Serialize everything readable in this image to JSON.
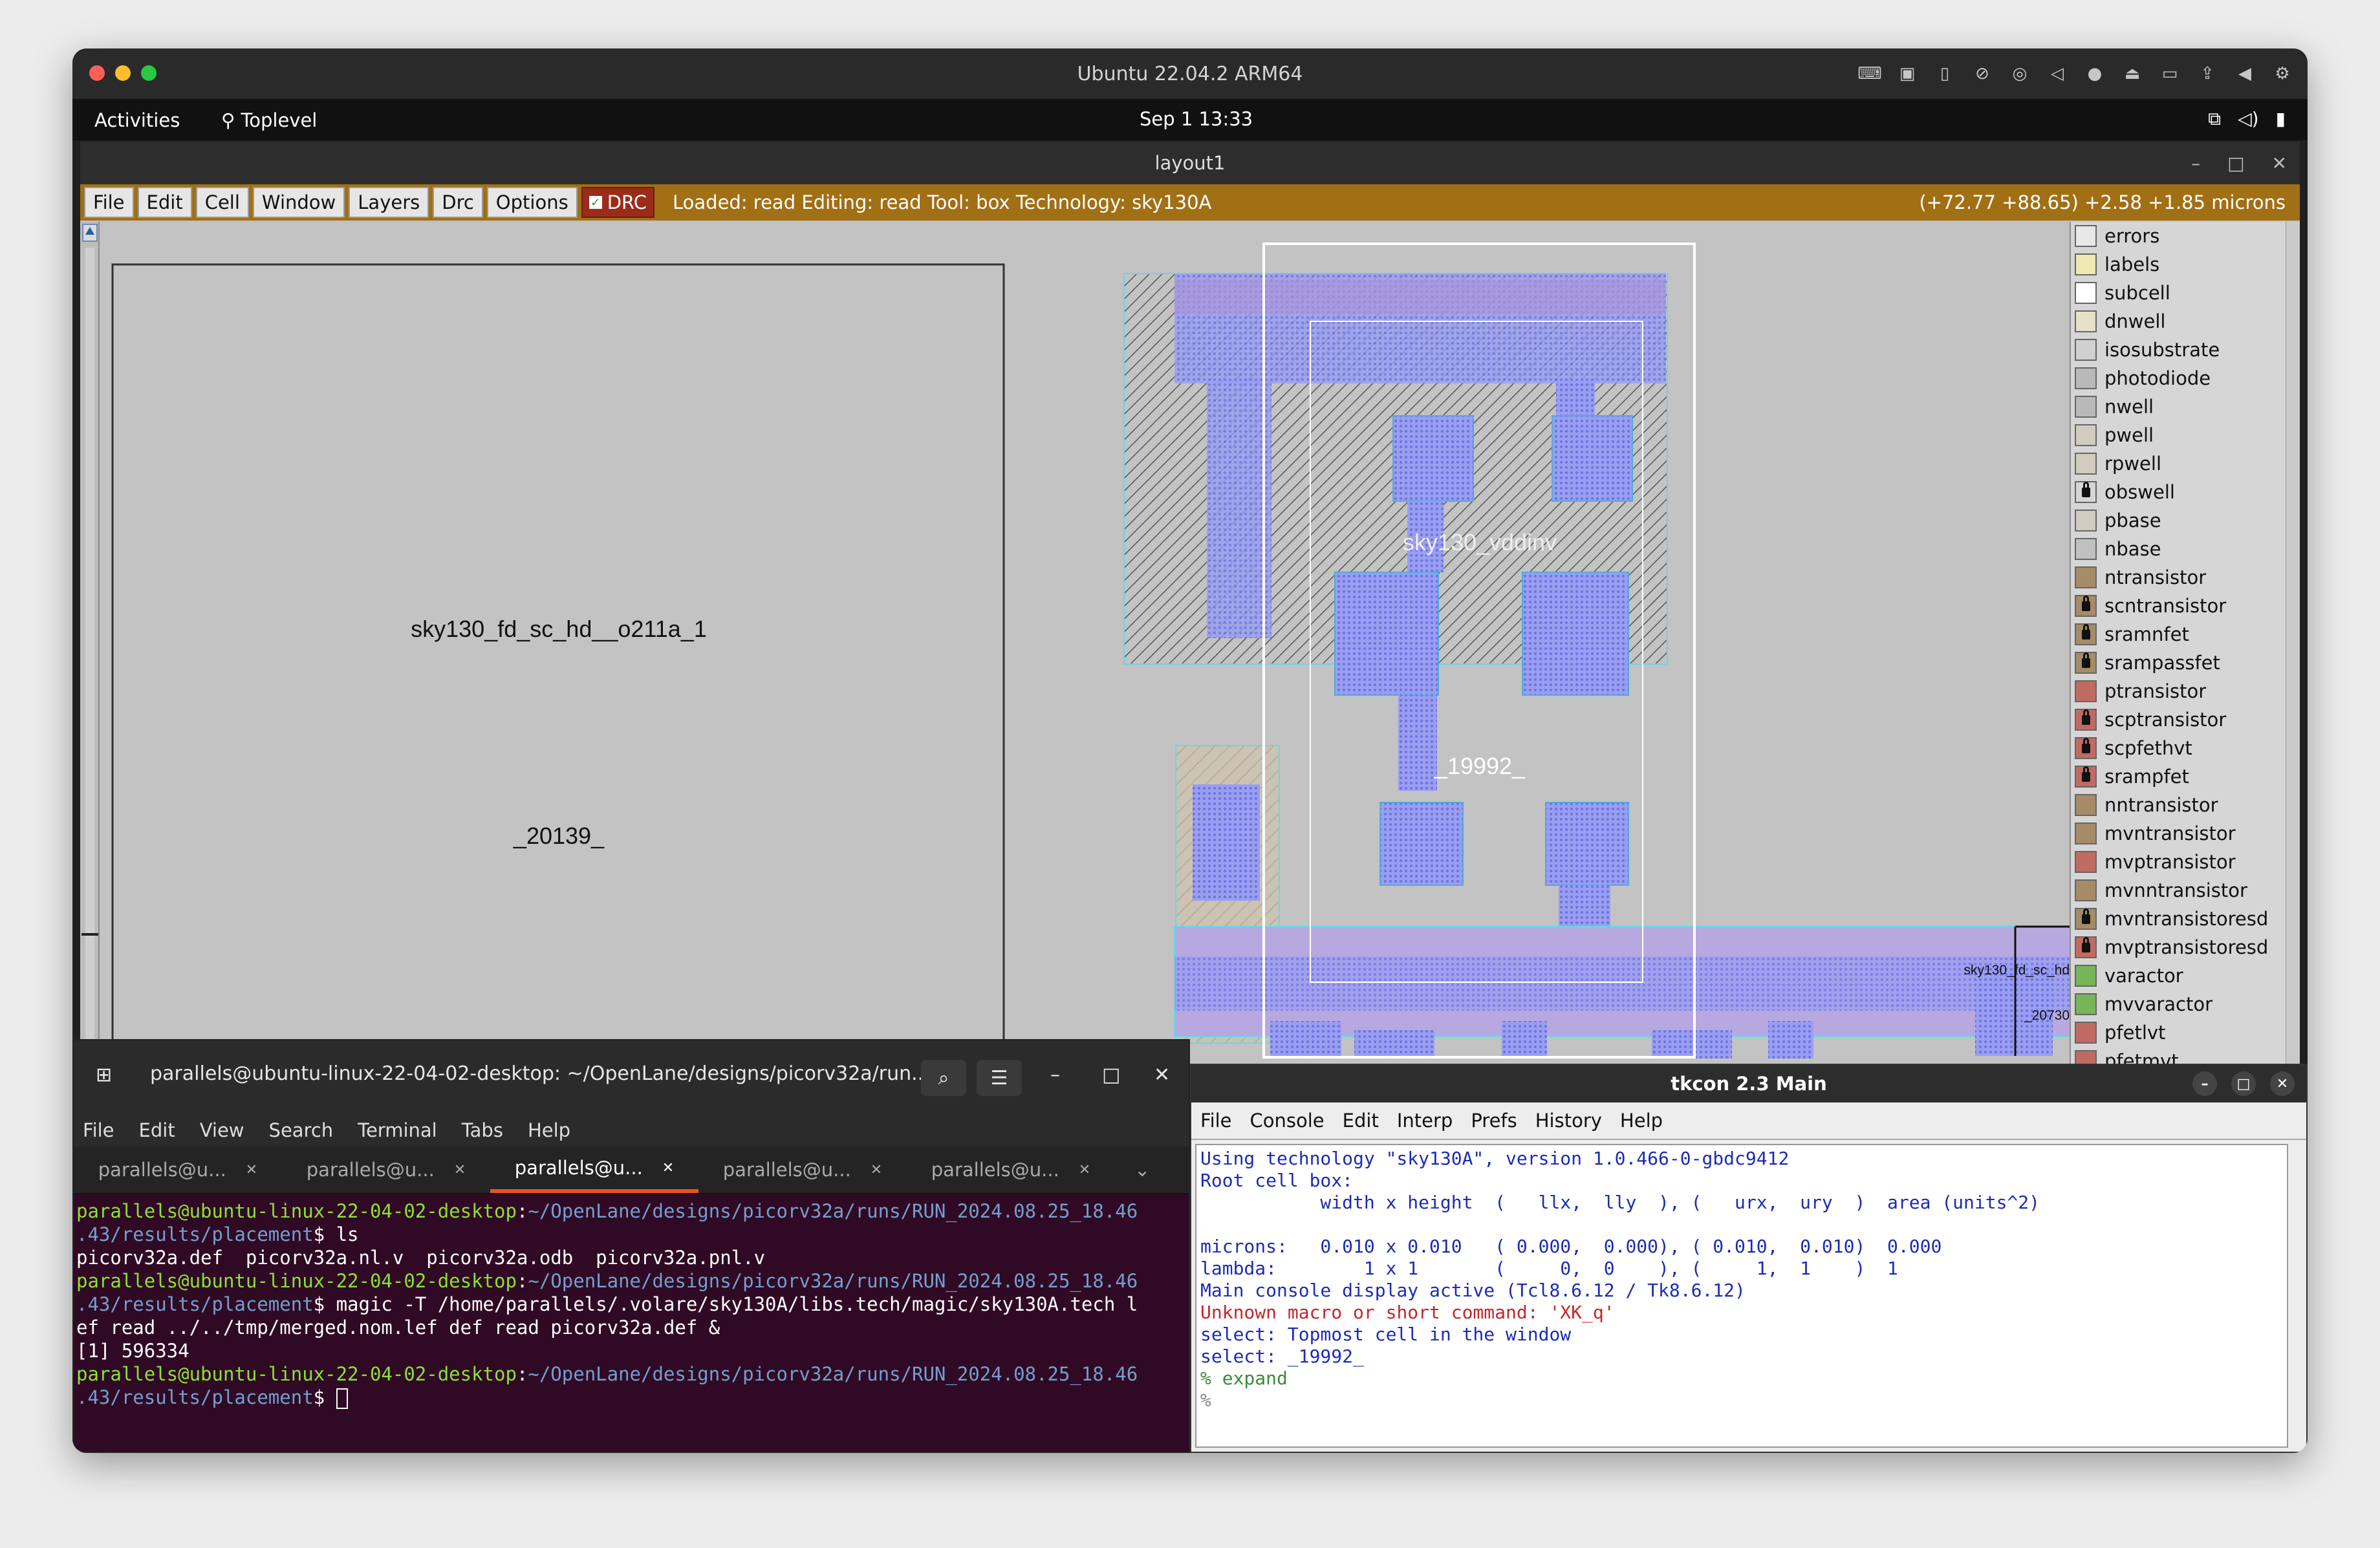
{
  "os_title": "Ubuntu 22.04.2 ARM64",
  "gnome": {
    "activities": "Activities",
    "app": "Toplevel",
    "clock": "Sep 1  13:33"
  },
  "layout": {
    "title": "layout1",
    "menus": [
      "File",
      "Edit",
      "Cell",
      "Window",
      "Layers",
      "Drc",
      "Options"
    ],
    "drc": "DRC",
    "status": "Loaded: read Editing: read Tool: box  Technology: sky130A",
    "coords": "(+72.77 +88.65) +2.58 +1.85 microns",
    "cell_left": "sky130_fd_sc_hd__o211a_1",
    "inst_left": "_20139_",
    "cell_mid": "sky130_vddinv",
    "inst_mid": "_19992_",
    "cell_right": "sky130_fd_sc_hd",
    "inst_right": "_20730"
  },
  "layers": [
    {
      "name": "errors",
      "color": "#e8e8e8",
      "lock": false
    },
    {
      "name": "labels",
      "color": "#f0e8b0",
      "lock": false
    },
    {
      "name": "subcell",
      "color": "#ffffff",
      "lock": false
    },
    {
      "name": "dnwell",
      "color": "#e6e2c9",
      "lock": false
    },
    {
      "name": "isosubstrate",
      "color": "#d0d0d0",
      "lock": false
    },
    {
      "name": "photodiode",
      "color": "#b9b9b9",
      "lock": false
    },
    {
      "name": "nwell",
      "color": "#b9b9b9",
      "lock": false
    },
    {
      "name": "pwell",
      "color": "#d0ccc0",
      "lock": false
    },
    {
      "name": "rpwell",
      "color": "#d0ccc0",
      "lock": false
    },
    {
      "name": "obswell",
      "color": "#d6d6d6",
      "lock": true
    },
    {
      "name": "pbase",
      "color": "#d0ccc0",
      "lock": false
    },
    {
      "name": "nbase",
      "color": "#c0c0c0",
      "lock": false
    },
    {
      "name": "ntransistor",
      "color": "#a68b68",
      "lock": false
    },
    {
      "name": "scntransistor",
      "color": "#a68b68",
      "lock": true
    },
    {
      "name": "sramnfet",
      "color": "#a68b68",
      "lock": true
    },
    {
      "name": "srampassfet",
      "color": "#a68b68",
      "lock": true
    },
    {
      "name": "ptransistor",
      "color": "#c06b62",
      "lock": false
    },
    {
      "name": "scptransistor",
      "color": "#c06b62",
      "lock": true
    },
    {
      "name": "scpfethvt",
      "color": "#c06b62",
      "lock": true
    },
    {
      "name": "srampfet",
      "color": "#c06b62",
      "lock": true
    },
    {
      "name": "nntransistor",
      "color": "#a68b68",
      "lock": false
    },
    {
      "name": "mvntransistor",
      "color": "#a68b68",
      "lock": false
    },
    {
      "name": "mvptransistor",
      "color": "#c06b62",
      "lock": false
    },
    {
      "name": "mvnntransistor",
      "color": "#a68b68",
      "lock": false
    },
    {
      "name": "mvntransistoresd",
      "color": "#a68b68",
      "lock": true
    },
    {
      "name": "mvptransistoresd",
      "color": "#c06b62",
      "lock": true
    },
    {
      "name": "varactor",
      "color": "#78b45a",
      "lock": false
    },
    {
      "name": "mvvaractor",
      "color": "#78b45a",
      "lock": false
    },
    {
      "name": "pfetlvt",
      "color": "#c06b62",
      "lock": false
    },
    {
      "name": "pfetmvt",
      "color": "#c06b62",
      "lock": false
    }
  ],
  "terminal": {
    "title": "parallels@ubuntu-linux-22-04-02-desktop: ~/OpenLane/designs/picorv32a/run...",
    "menus": [
      "File",
      "Edit",
      "View",
      "Search",
      "Terminal",
      "Tabs",
      "Help"
    ],
    "tabs": [
      "parallels@u...",
      "parallels@u...",
      "parallels@u...",
      "parallels@u...",
      "parallels@u..."
    ],
    "prompt": "parallels@ubuntu-linux-22-04-02-desktop",
    "path1": "~/OpenLane/designs/picorv32a/runs/RUN_2024.08.25_18.46",
    "path2": ".43/results/placement",
    "cmd1": "$ ls",
    "out1": "picorv32a.def  picorv32a.nl.v  picorv32a.odb  picorv32a.pnl.v",
    "cmd2": "$ magic -T /home/parallels/.volare/sky130A/libs.tech/magic/sky130A.tech l",
    "cmd2b": "ef read ../../tmp/merged.nom.lef def read picorv32a.def &",
    "out2": "[1] 596334",
    "cmd3": "$ "
  },
  "tkcon": {
    "title": "tkcon 2.3 Main",
    "menus": [
      "File",
      "Console",
      "Edit",
      "Interp",
      "Prefs",
      "History",
      "Help"
    ],
    "lines": [
      "Using technology \"sky130A\", version 1.0.466-0-gbdc9412",
      "Root cell box:",
      "           width x height  (   llx,  lly  ), (   urx,  ury  )  area (units^2)",
      "",
      "microns:   0.010 x 0.010   ( 0.000,  0.000), ( 0.010,  0.010)  0.000",
      "lambda:        1 x 1       (     0,  0    ), (     1,  1    )  1",
      "Main console display active (Tcl8.6.12 / Tk8.6.12)"
    ],
    "error": "Unknown macro or short command: 'XK_q'",
    "lines2": [
      "select: Topmost cell in the window",
      "select: _19992_"
    ],
    "expand": "% expand",
    "prompt": "%"
  }
}
